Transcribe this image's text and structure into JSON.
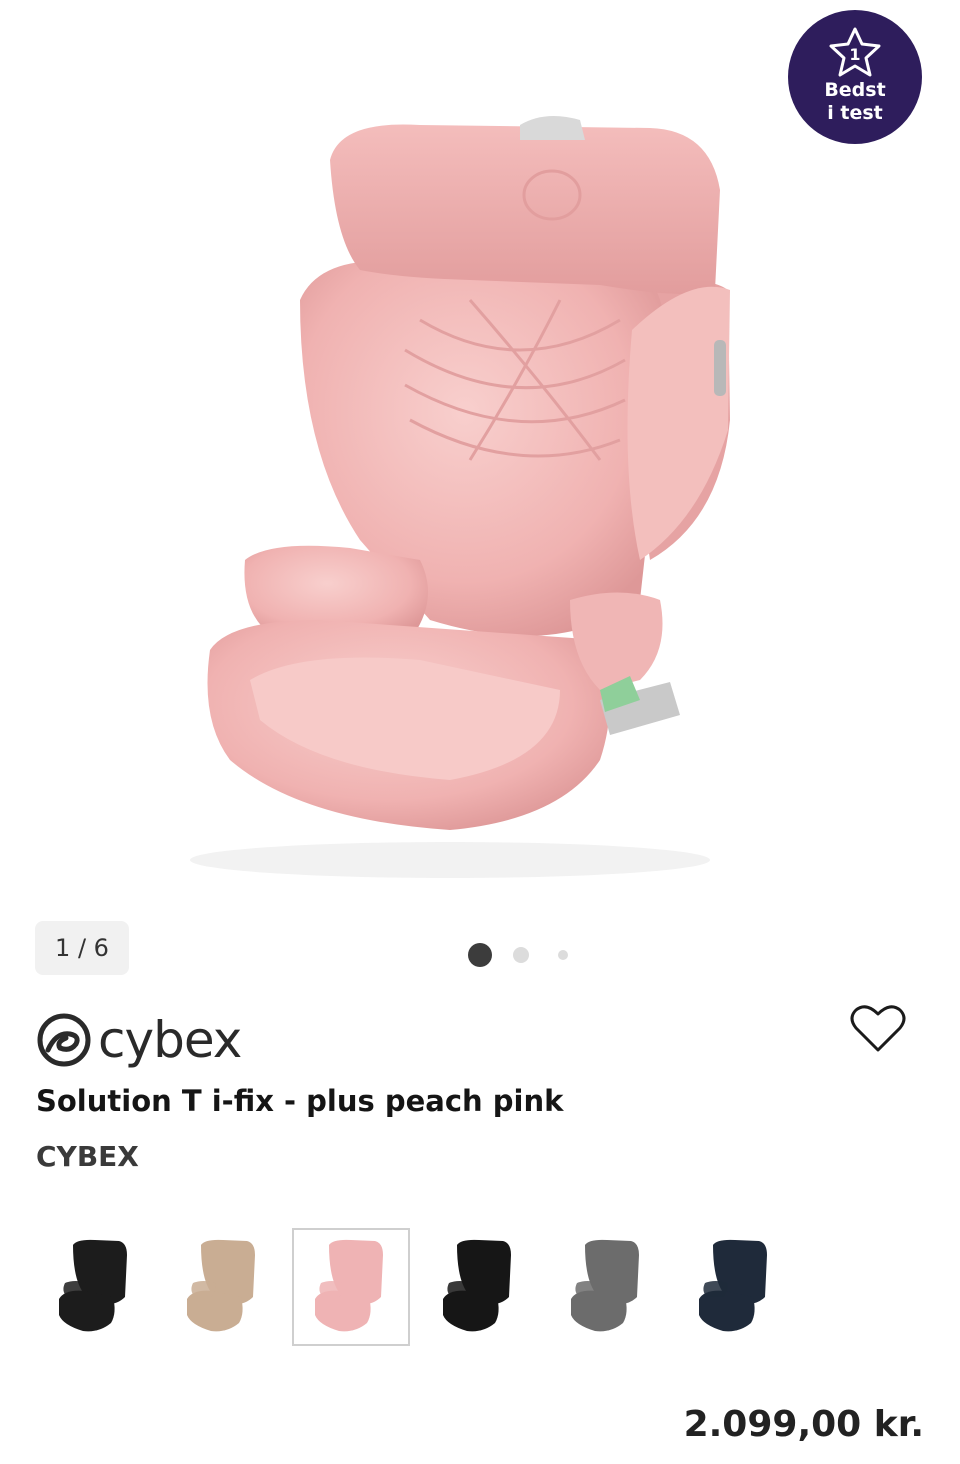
{
  "badge": {
    "line1": "Bedst",
    "line2": "i test",
    "rank": "1",
    "color": "#2e1d5c"
  },
  "gallery": {
    "counter": "1 / 6",
    "active_dot": 1,
    "dot_count": 3
  },
  "product": {
    "logo_text": "cybex",
    "title": "Solution T i-fix - plus peach pink",
    "brand": "CYBEX",
    "price": "2.099,00 kr."
  },
  "variants": [
    {
      "color": "black",
      "hex": "#1c1c1c",
      "selected": false
    },
    {
      "color": "beige",
      "hex": "#c9ad93",
      "selected": false
    },
    {
      "color": "peach-pink",
      "hex": "#efb3b4",
      "selected": true
    },
    {
      "color": "black-green",
      "hex": "#161616",
      "selected": false
    },
    {
      "color": "grey",
      "hex": "#6c6c6c",
      "selected": false
    },
    {
      "color": "navy",
      "hex": "#1f2a3a",
      "selected": false
    }
  ],
  "colors": {
    "seat_main": "#f2b7b6",
    "seat_shade": "#e39c9c",
    "seat_light": "#f8cfcd"
  }
}
